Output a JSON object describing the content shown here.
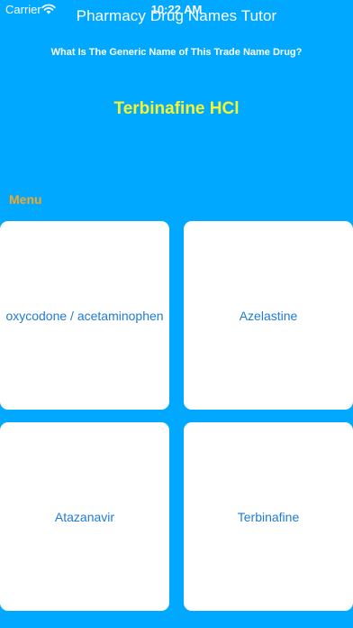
{
  "status_bar": {
    "carrier": "Carrier",
    "time": "10:22 AM",
    "wifi_icon": "wifi-icon"
  },
  "app": {
    "title": "Pharmacy Drug Names Tutor"
  },
  "quiz": {
    "question": "What Is The Generic Name of This Trade Name Drug?",
    "drug_name": "Terbinafine HCl"
  },
  "menu": {
    "label": "Menu"
  },
  "answers": [
    {
      "label": "oxycodone / acetaminophen"
    },
    {
      "label": "Azelastine"
    },
    {
      "label": "Atazanavir"
    },
    {
      "label": "Terbinafine"
    }
  ],
  "colors": {
    "background": "#00A9FF",
    "drug_name": "#F5F532",
    "menu_label": "#F5A623",
    "answer_text": "#1E7BD8",
    "card": "#FFFFFF"
  }
}
